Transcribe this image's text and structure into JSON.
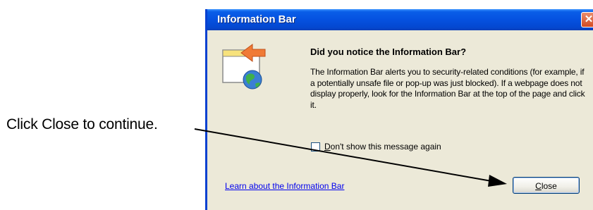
{
  "annotation": {
    "text": "Click Close to continue."
  },
  "dialog": {
    "title": "Information Bar",
    "close_glyph": "✕",
    "heading": "Did you notice the Information Bar?",
    "body": "The Information Bar alerts you to security-related conditions (for example, if a potentially unsafe file or pop-up was just blocked). If a webpage does not display properly, look for the Information Bar at the top of the page and click it.",
    "checkbox": {
      "label": "Don't show this message again",
      "checked": false
    },
    "link": "Learn about the Information Bar",
    "close_button": "Close"
  },
  "colors": {
    "titlebar": "#0551e0",
    "dialog_bg": "#ece9d8",
    "close_x": "#d44a22",
    "link": "#0000ee",
    "info_arrow": "#f07a35"
  }
}
